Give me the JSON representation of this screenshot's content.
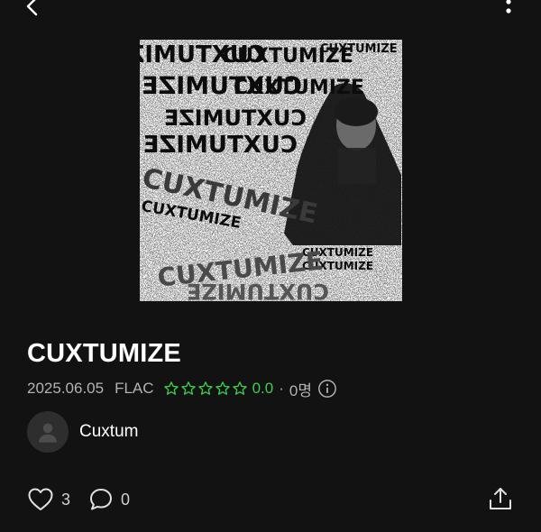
{
  "header": {
    "back_icon": "chevron-left-icon",
    "more_icon": "more-vertical-icon"
  },
  "album": {
    "cover_text": "CUXTUMIZE",
    "title": "CUXTUMIZE",
    "release_date": "2025.06.05",
    "format": "FLAC",
    "rating": {
      "stars_total": 5,
      "stars_filled": 0,
      "value": "0.0",
      "separator": "·",
      "count": "0명"
    },
    "info_icon": "info-icon"
  },
  "artist": {
    "name": "Cuxtum",
    "avatar_icon": "person-icon"
  },
  "actions": {
    "likes": "3",
    "comments": "0",
    "share_icon": "share-icon"
  },
  "colors": {
    "background": "#121212",
    "accent_green": "#3fcd4c",
    "secondary_text": "#b3b3b3"
  }
}
